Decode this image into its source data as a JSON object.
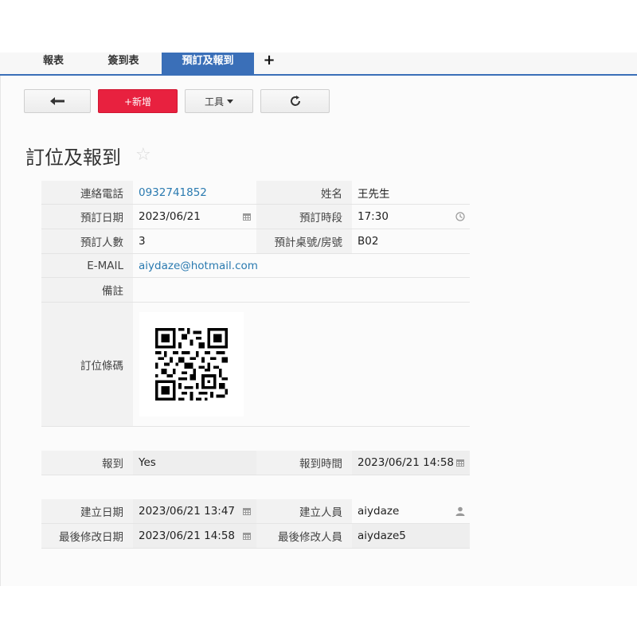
{
  "tabs": [
    {
      "label": "報表"
    },
    {
      "label": "簽到表"
    },
    {
      "label": "預訂及報到",
      "active": true
    }
  ],
  "tab_add_label": "+",
  "toolbar": {
    "new_label": "+新增",
    "tools_label": "工具"
  },
  "page_title": "訂位及報到",
  "form": {
    "phone_label": "連絡電話",
    "phone": "0932741852",
    "name_label": "姓名",
    "name": "王先生",
    "date_label": "預訂日期",
    "date": "2023/06/21",
    "time_label": "預訂時段",
    "time": "17:30",
    "people_label": "預訂人數",
    "people": "3",
    "table_label": "預計桌號/房號",
    "table": "B02",
    "email_label": "E-MAIL",
    "email": "aiydaze@hotmail.com",
    "note_label": "備註",
    "note": "",
    "barcode_label": "訂位條碼"
  },
  "checkin": {
    "checkin_label": "報到",
    "checkin": "Yes",
    "checkin_time_label": "報到時間",
    "checkin_time": "2023/06/21 14:58"
  },
  "meta": {
    "created_date_label": "建立日期",
    "created_date": "2023/06/21 13:47",
    "created_by_label": "建立人員",
    "created_by": "aiydaze",
    "modified_date_label": "最後修改日期",
    "modified_date": "2023/06/21 14:58",
    "modified_by_label": "最後修改人員",
    "modified_by": "aiydaze5"
  },
  "icons": {
    "back": "arrow-left-icon",
    "refresh": "refresh-icon",
    "calendar": "calendar-icon",
    "clock": "clock-icon",
    "user": "user-icon",
    "star": "star-icon"
  },
  "colors": {
    "accent": "#3a6fb8",
    "new_button": "#e8213f",
    "link": "#2a7ab0"
  }
}
